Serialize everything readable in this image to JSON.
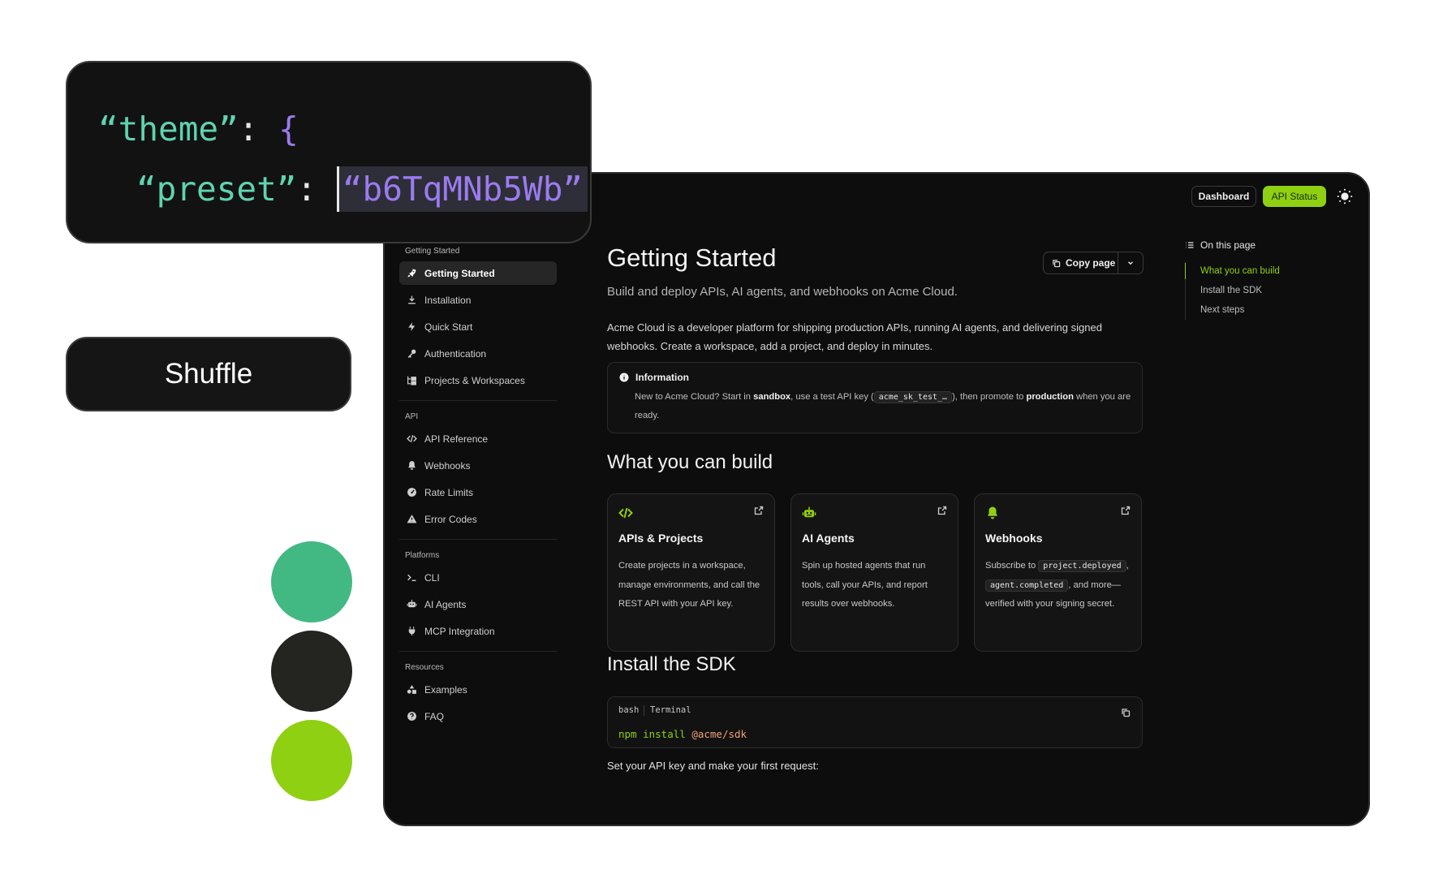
{
  "code_card": {
    "key1": "“theme”",
    "colon1": ": ",
    "brace": "{",
    "key2": "“preset”",
    "colon2": ": ",
    "value": "“b6TqMNb5Wb”"
  },
  "shuffle_label": "Shuffle",
  "swatches": [
    "#42b883",
    "#242420",
    "#8fd013"
  ],
  "topbar": {
    "dashboard_label": "Dashboard",
    "api_status_label": "API Status",
    "accent": "#8fd013"
  },
  "sidebar": {
    "sections": [
      {
        "title": "Getting Started",
        "items": [
          {
            "label": "Getting Started",
            "icon": "rocket-icon",
            "active": true
          },
          {
            "label": "Installation",
            "icon": "download-icon"
          },
          {
            "label": "Quick Start",
            "icon": "lightning-icon"
          },
          {
            "label": "Authentication",
            "icon": "key-icon"
          },
          {
            "label": "Projects & Workspaces",
            "icon": "folder-tree-icon"
          }
        ]
      },
      {
        "title": "API",
        "items": [
          {
            "label": "API Reference",
            "icon": "code-icon"
          },
          {
            "label": "Webhooks",
            "icon": "bell-icon"
          },
          {
            "label": "Rate Limits",
            "icon": "gauge-icon"
          },
          {
            "label": "Error Codes",
            "icon": "warning-icon"
          }
        ]
      },
      {
        "title": "Platforms",
        "items": [
          {
            "label": "CLI",
            "icon": "terminal-icon"
          },
          {
            "label": "AI Agents",
            "icon": "robot-icon"
          },
          {
            "label": "MCP Integration",
            "icon": "plug-icon"
          }
        ]
      },
      {
        "title": "Resources",
        "items": [
          {
            "label": "Examples",
            "icon": "shapes-icon"
          },
          {
            "label": "FAQ",
            "icon": "help-icon"
          }
        ]
      }
    ]
  },
  "main": {
    "title": "Getting Started",
    "subtitle": "Build and deploy APIs, AI agents, and webhooks on Acme Cloud.",
    "copy_page_label": "Copy page",
    "intro": "Acme Cloud is a developer platform for shipping production APIs, running AI agents, and delivering signed webhooks. Create a workspace, add a project, and deploy in minutes.",
    "info": {
      "title": "Information",
      "p1": "New to Acme Cloud? Start in ",
      "b1": "sandbox",
      "p2": ", use a test API key (",
      "code": "acme_sk_test_…",
      "p3": "), then promote to ",
      "b2": "production",
      "p4": " when you are ready."
    },
    "build_heading": "What you can build",
    "cards": [
      {
        "title": "APIs & Projects",
        "icon": "code-icon",
        "desc": "Create projects in a workspace, manage environments, and call the REST API with your API key."
      },
      {
        "title": "AI Agents",
        "icon": "robot-icon",
        "desc": "Spin up hosted agents that run tools, call your APIs, and report results over webhooks."
      },
      {
        "title": "Webhooks",
        "icon": "bell-icon",
        "desc_pre": "Subscribe to",
        "code1": "project.deployed",
        "desc_mid": ",",
        "code2": "agent.completed",
        "desc_post": ", and more—verified with your signing secret."
      }
    ],
    "sdk_heading": "Install the SDK",
    "codeblock": {
      "lang": "bash",
      "label": "Terminal",
      "cmd": "npm",
      "sub": " install ",
      "arg": "@acme/sdk"
    },
    "after_text": "Set your API key and make your first request:"
  },
  "toc": {
    "heading": "On this page",
    "items": [
      "What you can build",
      "Install the SDK",
      "Next steps"
    ]
  }
}
